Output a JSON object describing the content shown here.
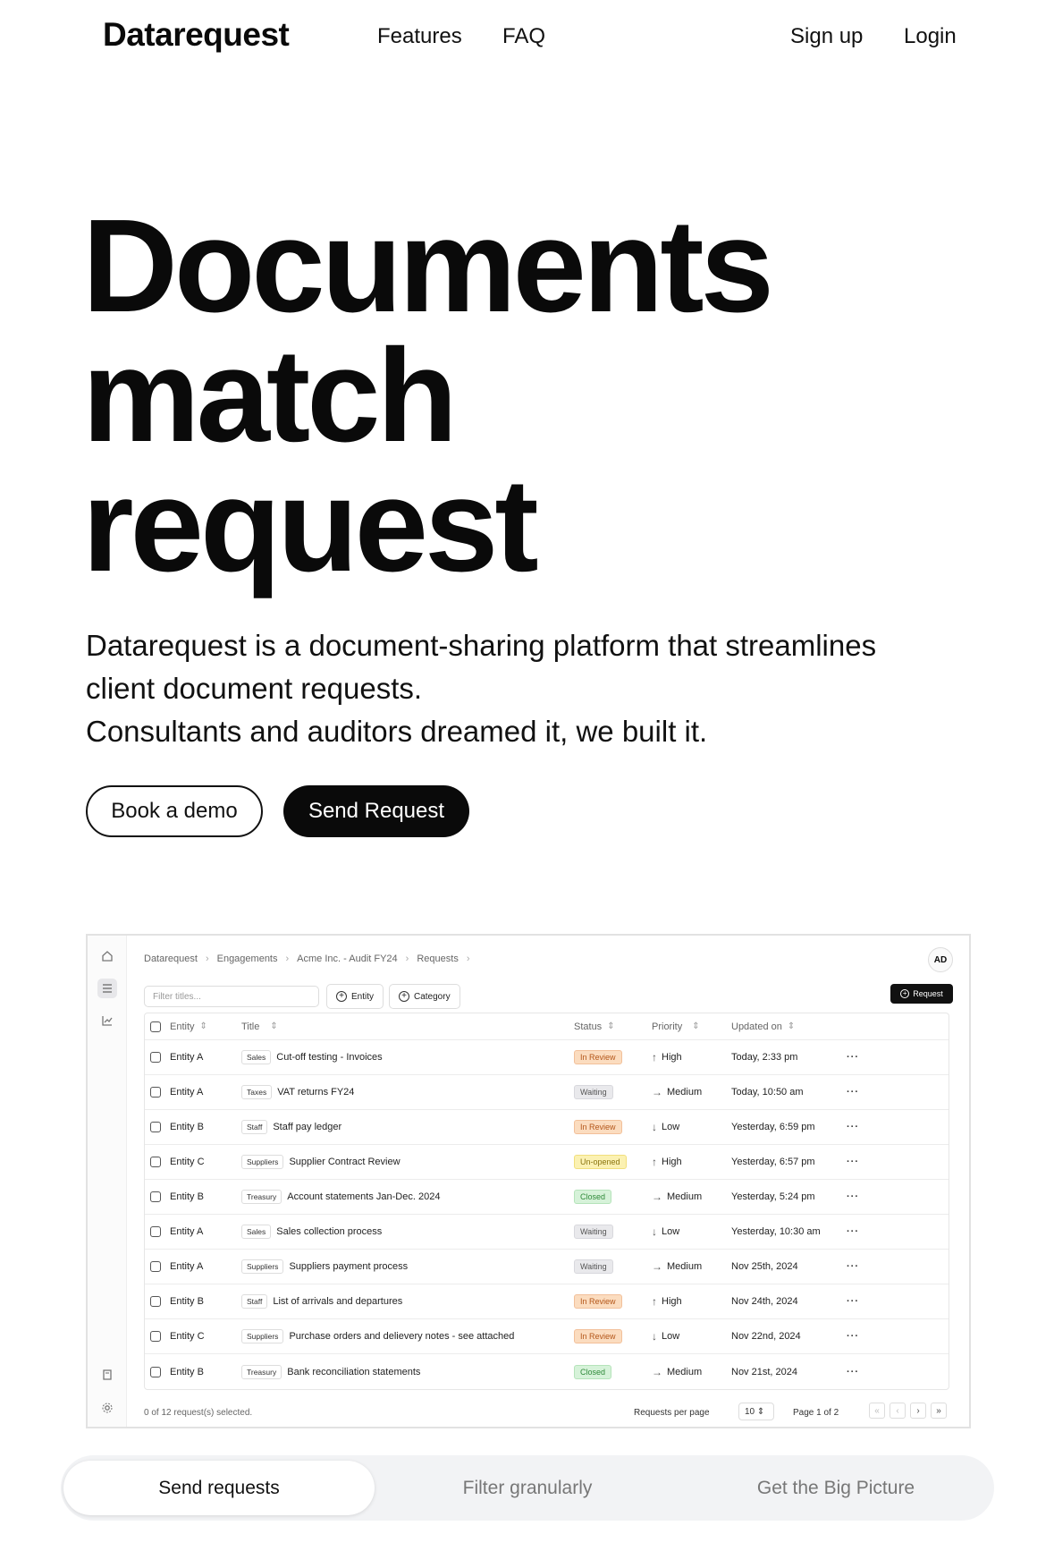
{
  "nav": {
    "logo": "Datarequest",
    "features": "Features",
    "faq": "FAQ",
    "signup": "Sign up",
    "login": "Login"
  },
  "hero": {
    "title_lines": [
      "Documents",
      "match",
      "request"
    ],
    "desc_lines": [
      "Datarequest is a document-sharing platform that streamlines",
      "client document requests.",
      "Consultants and auditors dreamed it, we built it."
    ],
    "demo_button": "Book a demo",
    "send_button": "Send Request"
  },
  "app": {
    "breadcrumb": [
      "Datarequest",
      "Engagements",
      "Acme Inc. - Audit FY24",
      "Requests"
    ],
    "breadcrumb_sep": "›",
    "avatar": "AD",
    "filter_placeholder": "Filter titles...",
    "entity_button": "Entity",
    "category_button": "Category",
    "request_button": "Request",
    "columns": {
      "entity": "Entity",
      "title": "Title",
      "status": "Status",
      "priority": "Priority",
      "updated": "Updated on"
    },
    "rows": [
      {
        "entity": "Entity A",
        "category": "Sales",
        "title": "Cut-off testing - Invoices",
        "status": "In Review",
        "priority": "High",
        "updated": "Today, 2:33 pm"
      },
      {
        "entity": "Entity A",
        "category": "Taxes",
        "title": "VAT returns FY24",
        "status": "Waiting",
        "priority": "Medium",
        "updated": "Today, 10:50 am"
      },
      {
        "entity": "Entity B",
        "category": "Staff",
        "title": "Staff pay ledger",
        "status": "In Review",
        "priority": "Low",
        "updated": "Yesterday, 6:59 pm"
      },
      {
        "entity": "Entity C",
        "category": "Suppliers",
        "title": "Supplier Contract Review",
        "status": "Un-opened",
        "priority": "High",
        "updated": "Yesterday, 6:57 pm"
      },
      {
        "entity": "Entity B",
        "category": "Treasury",
        "title": "Account statements Jan-Dec. 2024",
        "status": "Closed",
        "priority": "Medium",
        "updated": "Yesterday, 5:24 pm"
      },
      {
        "entity": "Entity A",
        "category": "Sales",
        "title": "Sales collection process",
        "status": "Waiting",
        "priority": "Low",
        "updated": "Yesterday, 10:30 am"
      },
      {
        "entity": "Entity A",
        "category": "Suppliers",
        "title": "Suppliers payment process",
        "status": "Waiting",
        "priority": "Medium",
        "updated": "Nov 25th, 2024"
      },
      {
        "entity": "Entity B",
        "category": "Staff",
        "title": "List of arrivals and departures",
        "status": "In Review",
        "priority": "High",
        "updated": "Nov 24th, 2024"
      },
      {
        "entity": "Entity C",
        "category": "Suppliers",
        "title": "Purchase orders and delievery notes - see attached",
        "status": "In Review",
        "priority": "Low",
        "updated": "Nov 22nd, 2024"
      },
      {
        "entity": "Entity B",
        "category": "Treasury",
        "title": "Bank reconciliation statements",
        "status": "Closed",
        "priority": "Medium",
        "updated": "Nov 21st, 2024"
      }
    ],
    "more_glyph": "···",
    "selected_text": "0 of 12 request(s) selected.",
    "per_page_label": "Requests per page",
    "per_page_value": "10",
    "page_info": "Page 1 of 2",
    "rail_icons": [
      "home-icon",
      "list-icon",
      "chart-icon",
      "book-icon",
      "gear-icon"
    ]
  },
  "tabs": [
    "Send requests",
    "Filter granularly",
    "Get the Big Picture"
  ],
  "colors": {
    "accent": "#0a0a0a",
    "in_review": "#fbdcbf",
    "waiting": "#e9e9ec",
    "unopened": "#fbf1b2",
    "closed": "#d6f2d9"
  }
}
